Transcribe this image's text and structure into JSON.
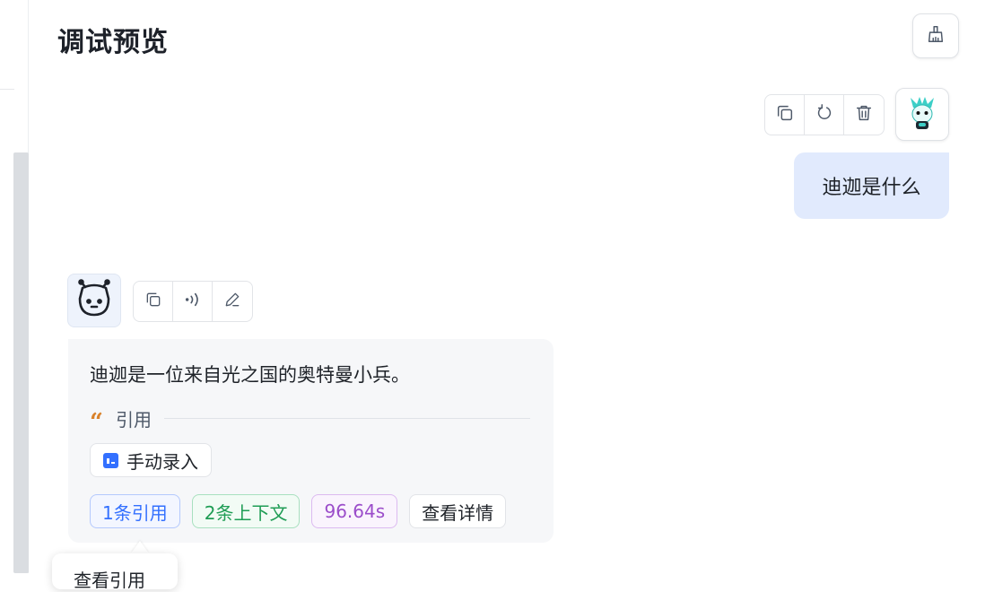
{
  "header": {
    "title": "调试预览",
    "clear_icon": "broom-icon"
  },
  "user_message": {
    "text": "迪迦是什么",
    "actions": [
      "copy-icon",
      "retry-icon",
      "delete-icon"
    ],
    "avatar": "ultraman-avatar"
  },
  "bot_message": {
    "avatar": "robot-avatar",
    "actions": [
      "copy-icon",
      "voice-icon",
      "edit-icon"
    ],
    "text": "迪迦是一位来自光之国的奥特曼小兵。",
    "quote_label": "引用",
    "source_label": "手动录入",
    "tags": {
      "citations": "1条引用",
      "context": "2条上下文",
      "duration": "96.64s",
      "details": "查看详情"
    }
  },
  "tooltip": {
    "text": "查看引用"
  },
  "colors": {
    "accent_blue": "#3370ff",
    "user_bubble": "#e1eafd",
    "bot_card": "#f6f7f9"
  }
}
